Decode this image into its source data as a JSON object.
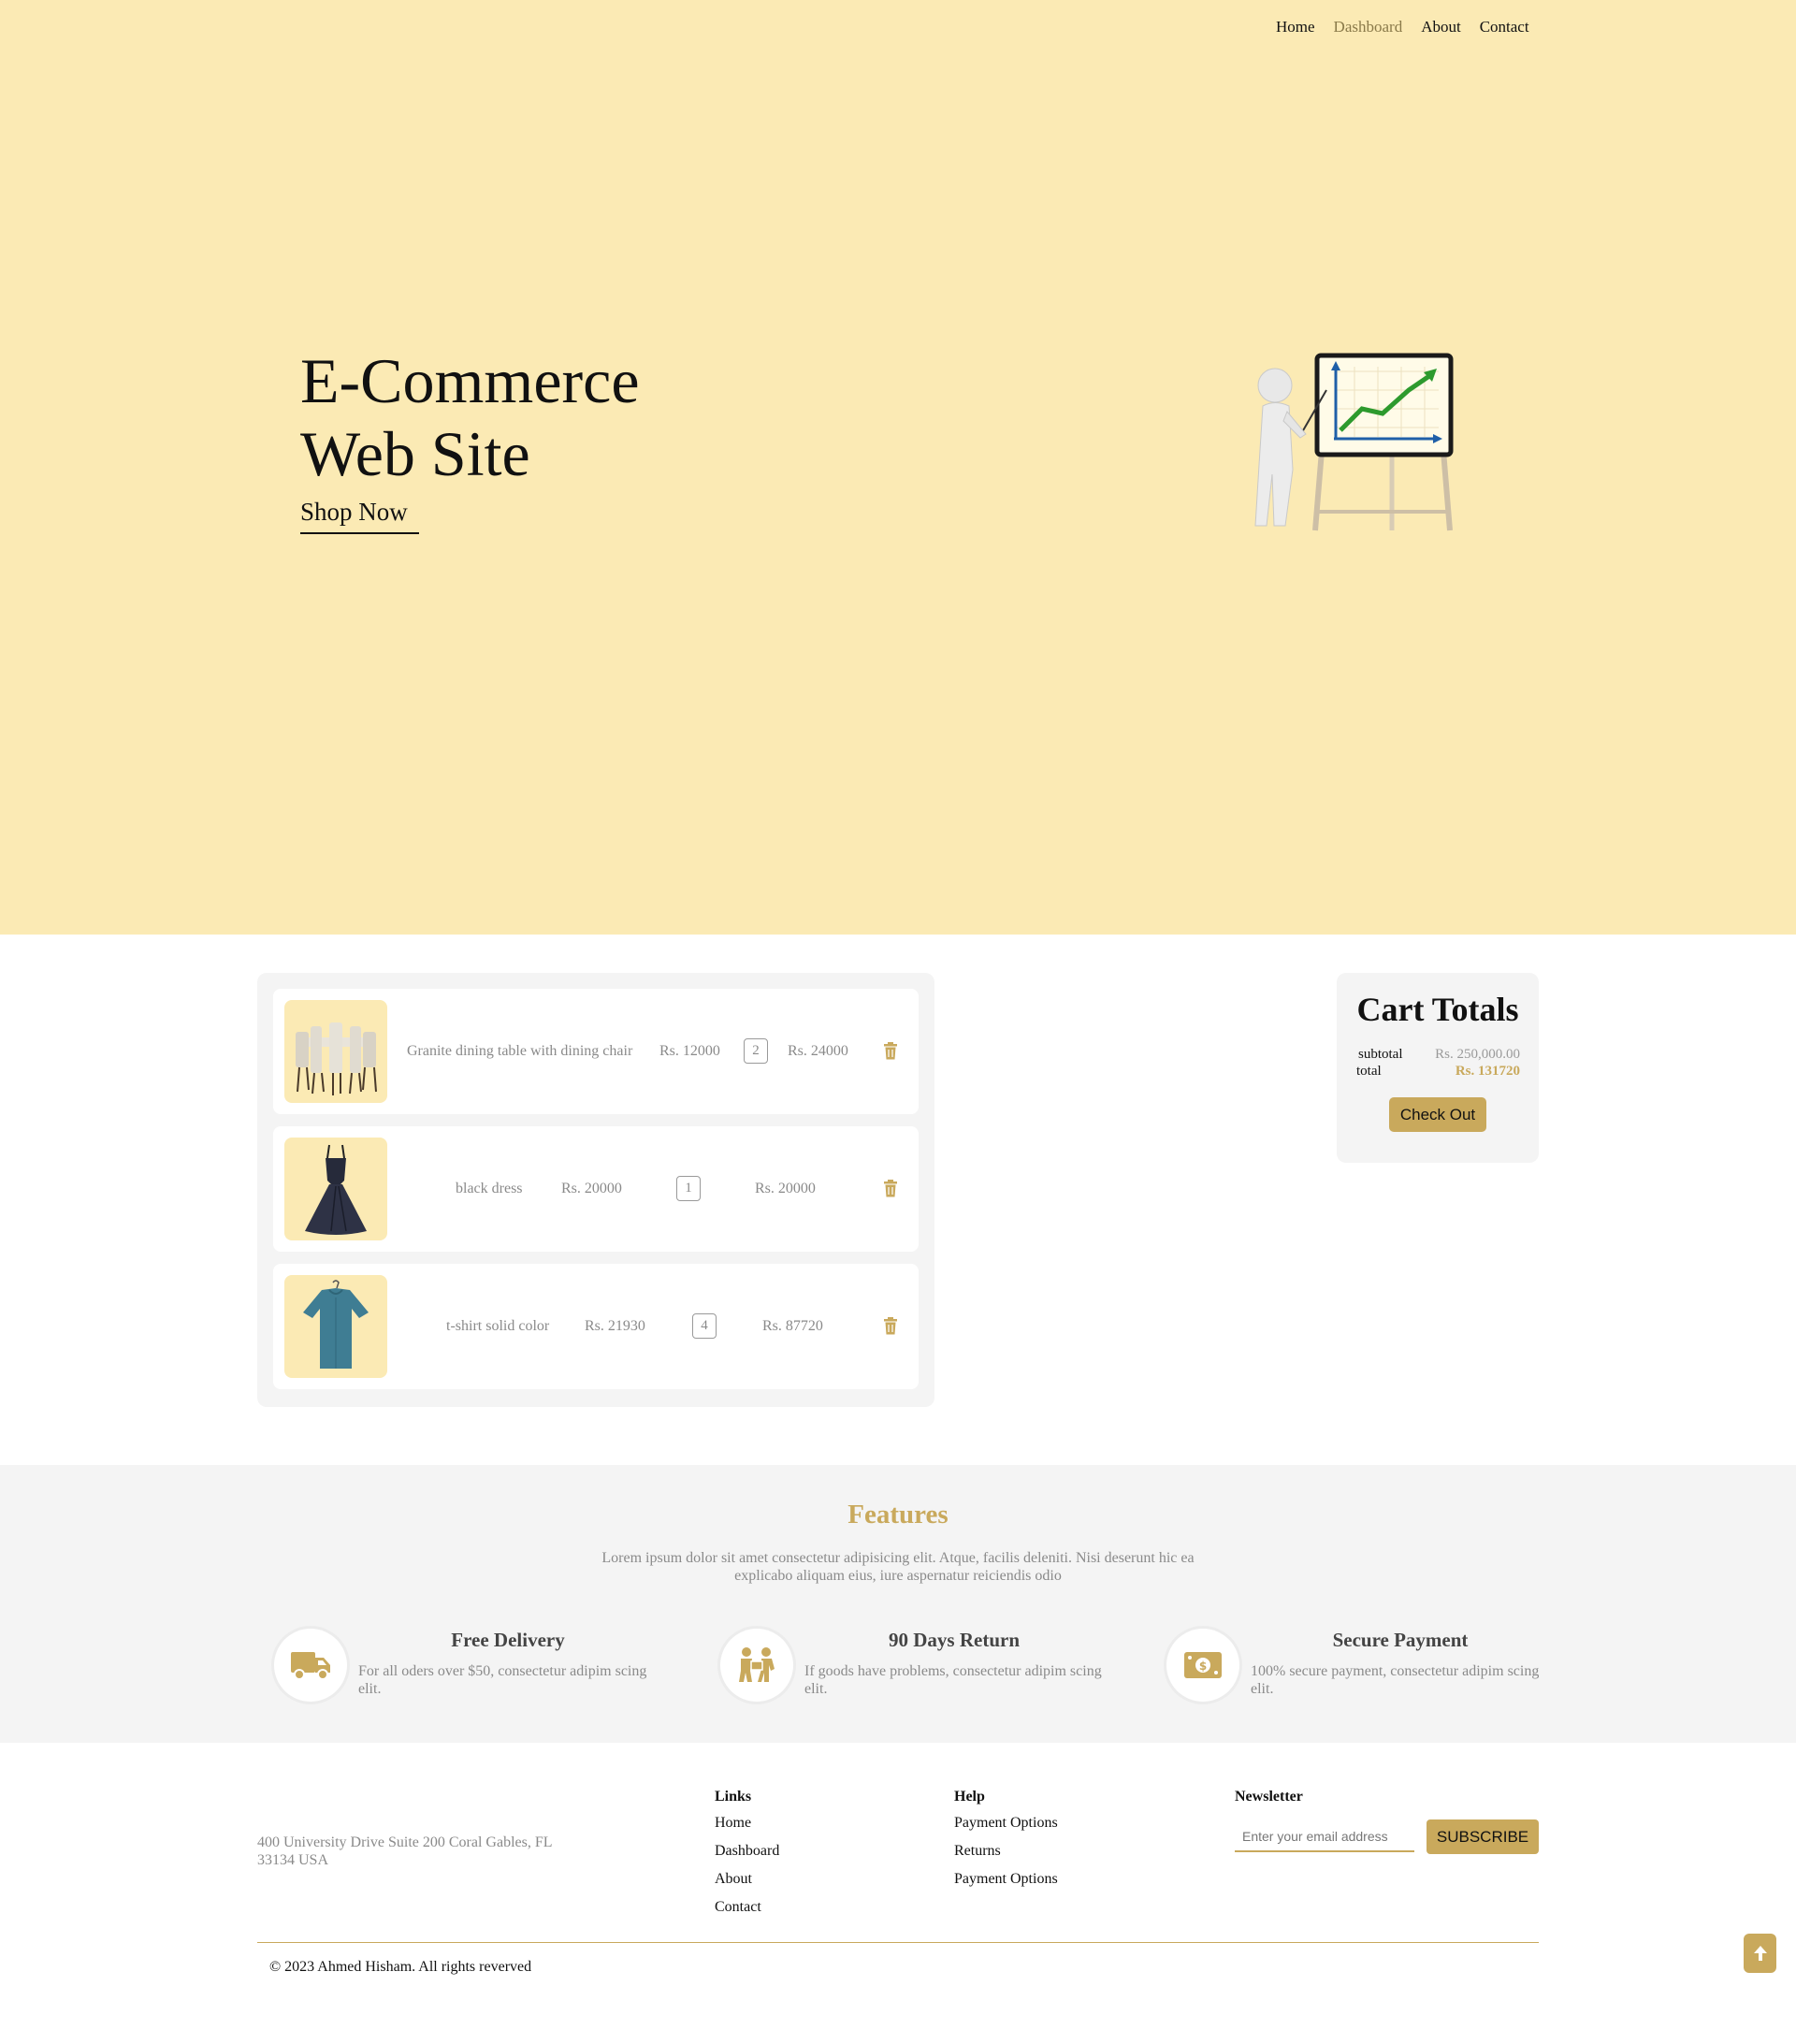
{
  "nav": {
    "items": [
      {
        "label": "Home",
        "active": false
      },
      {
        "label": "Dashboard",
        "active": true
      },
      {
        "label": "About",
        "active": false
      },
      {
        "label": "Contact",
        "active": false
      }
    ]
  },
  "hero": {
    "title_line1": "E-Commerce",
    "title_line2": "Web Site",
    "cta": "Shop Now",
    "illustration_icon": "presenter-chart-illustration"
  },
  "cart": {
    "items": [
      {
        "name": "Granite dining table with dining chair",
        "price": "Rs. 12000",
        "quantity": "2",
        "subtotal": "Rs. 24000",
        "image_icon": "dining-table-image"
      },
      {
        "name": "black dress",
        "price": "Rs. 20000",
        "quantity": "1",
        "subtotal": "Rs. 20000",
        "image_icon": "black-dress-image"
      },
      {
        "name": "t-shirt solid color",
        "price": "Rs. 21930",
        "quantity": "4",
        "subtotal": "Rs. 87720",
        "image_icon": "tshirt-image"
      }
    ],
    "remove_icon": "trash-icon"
  },
  "totals": {
    "title": "Cart Totals",
    "subtotal_label": "subtotal",
    "subtotal_value": "Rs. 250,000.00",
    "total_label": "total",
    "total_value": "Rs. 131720",
    "checkout": "Check Out"
  },
  "features": {
    "title": "Features",
    "intro": "Lorem ipsum dolor sit amet consectetur adipisicing elit. Atque, facilis deleniti. Nisi deserunt hic ea explicabo aliquam eius, iure aspernatur reiciendis odio",
    "items": [
      {
        "title": "Free Delivery",
        "text": "For all oders over $50, consectetur adipim scing elit.",
        "icon": "truck-icon"
      },
      {
        "title": "90 Days Return",
        "text": "If goods have problems, consectetur adipim scing elit.",
        "icon": "return-people-icon"
      },
      {
        "title": "Secure Payment",
        "text": "100% secure payment, consectetur adipim scing elit.",
        "icon": "money-bill-icon"
      }
    ]
  },
  "footer": {
    "address": "400 University Drive Suite 200 Coral Gables, FL 33134 USA",
    "links": {
      "title": "Links",
      "items": [
        "Home",
        "Dashboard",
        "About",
        "Contact"
      ]
    },
    "help": {
      "title": "Help",
      "items": [
        "Payment Options",
        "Returns",
        "Payment Options"
      ]
    },
    "newsletter": {
      "title": "Newsletter",
      "placeholder": "Enter your email address",
      "button": "SUBSCRIBE"
    },
    "copyright": "© 2023 Ahmed Hisham. All rights reverved"
  },
  "scroll_top_icon": "arrow-up-icon",
  "colors": {
    "hero_bg": "#fbeab4",
    "accent": "#c9a95c",
    "panel_bg": "#f4f4f4",
    "muted_text": "#8a8a8a"
  }
}
